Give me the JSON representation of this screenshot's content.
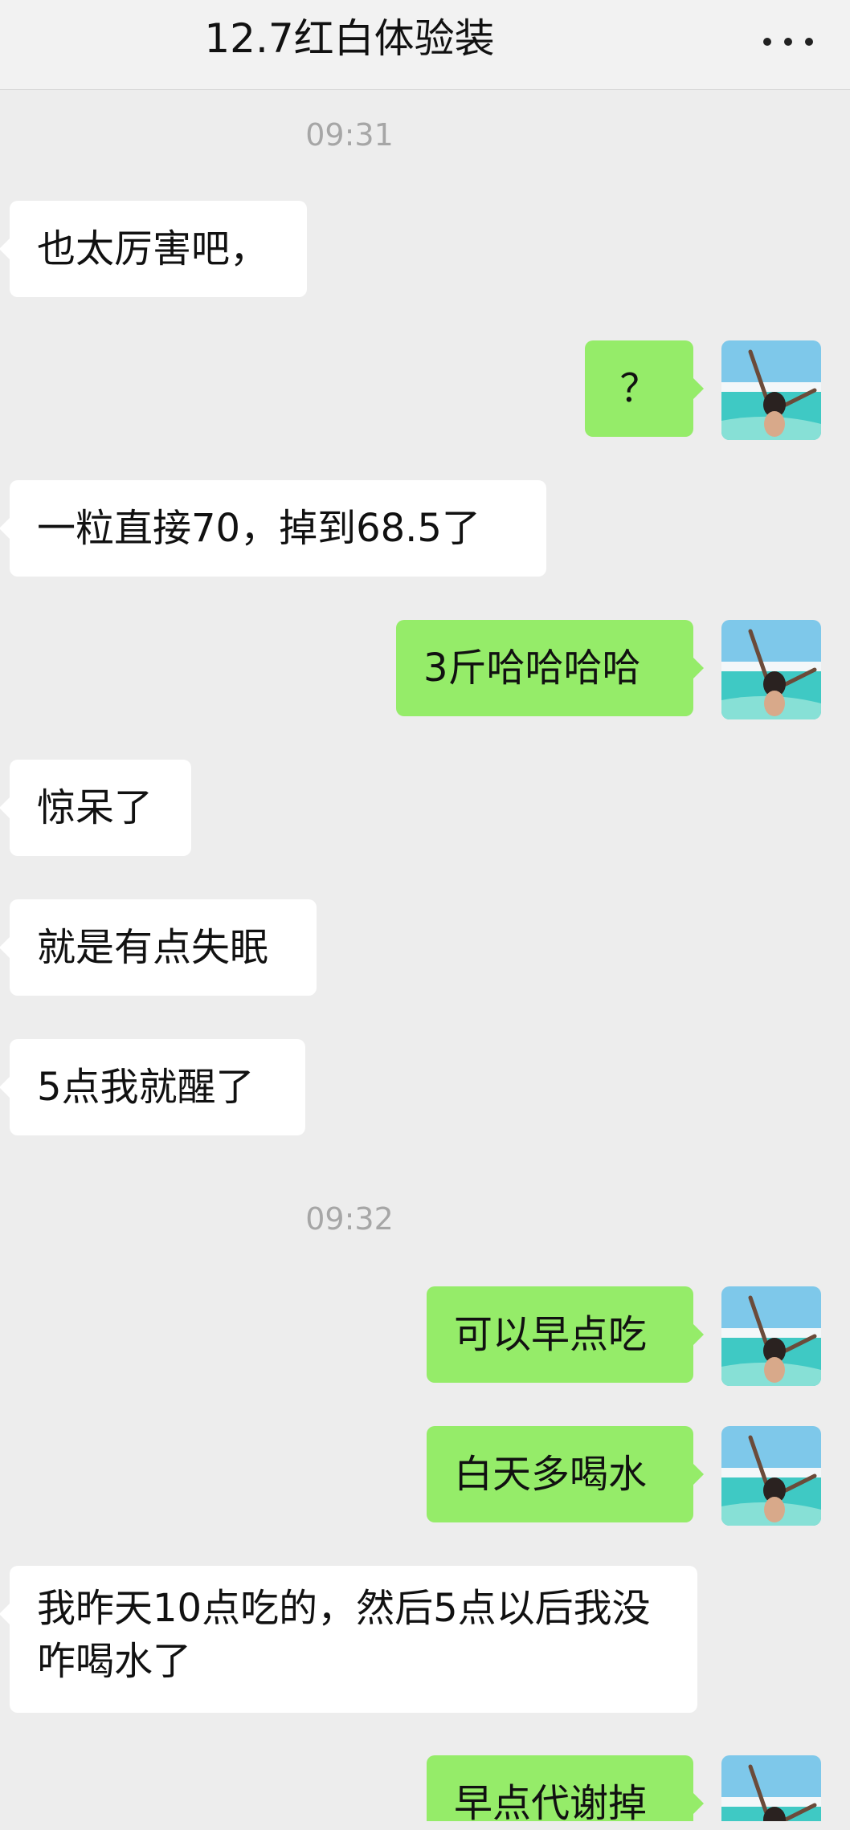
{
  "header": {
    "title": "12.7红白体验装",
    "more_icon": "more-dots-icon"
  },
  "timestamps": [
    "09:31",
    "09:32"
  ],
  "messages": [
    {
      "side": "in",
      "text": "也太厉害吧，"
    },
    {
      "side": "out",
      "text": "？"
    },
    {
      "side": "in",
      "text": "一粒直接70，掉到68.5了"
    },
    {
      "side": "out",
      "text": "3斤哈哈哈哈"
    },
    {
      "side": "in",
      "text": "惊呆了"
    },
    {
      "side": "in",
      "text": "就是有点失眠"
    },
    {
      "side": "in",
      "text": "5点我就醒了"
    },
    {
      "side": "out",
      "text": "可以早点吃"
    },
    {
      "side": "out",
      "text": "白天多喝水"
    },
    {
      "side": "in",
      "text": "我昨天10点吃的，然后5点以后我没咋喝水了"
    },
    {
      "side": "out",
      "text": "早点代谢掉"
    }
  ],
  "colors": {
    "background": "#ededed",
    "incoming_bubble": "#ffffff",
    "outgoing_bubble": "#95ec69",
    "timestamp_text": "#a6a6a6"
  },
  "avatar": {
    "icon": "beach-avatar-icon"
  }
}
